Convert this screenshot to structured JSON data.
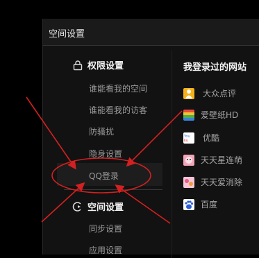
{
  "header": {
    "title": "空间设置"
  },
  "permission_section": {
    "title": "权限设置",
    "icon": "lock-icon",
    "items": [
      {
        "label": "谁能看我的空间"
      },
      {
        "label": "谁能看我的访客"
      },
      {
        "label": "防骚扰"
      },
      {
        "label": "隐身设置"
      },
      {
        "label": "QQ登录"
      }
    ]
  },
  "space_section": {
    "title": "空间设置",
    "icon": "space-settings-icon",
    "items": [
      {
        "label": "同步设置"
      },
      {
        "label": "应用设置"
      }
    ]
  },
  "sites": {
    "title": "我登录过的网站",
    "items": [
      {
        "label": "大众点评",
        "icon": "dianping-icon"
      },
      {
        "label": "爱壁纸HD",
        "icon": "aibizhi-icon"
      },
      {
        "label": "优酷",
        "icon": "youku-icon"
      },
      {
        "label": "天天星连萌",
        "icon": "tiantian-xinglianmeng-icon"
      },
      {
        "label": "天天爱消除",
        "icon": "tiantian-aixiaochu-icon"
      },
      {
        "label": "百度",
        "icon": "baidu-icon"
      }
    ]
  },
  "colors": {
    "annotation_red": "#d42020",
    "background": "#000000",
    "panel": "#121212"
  }
}
